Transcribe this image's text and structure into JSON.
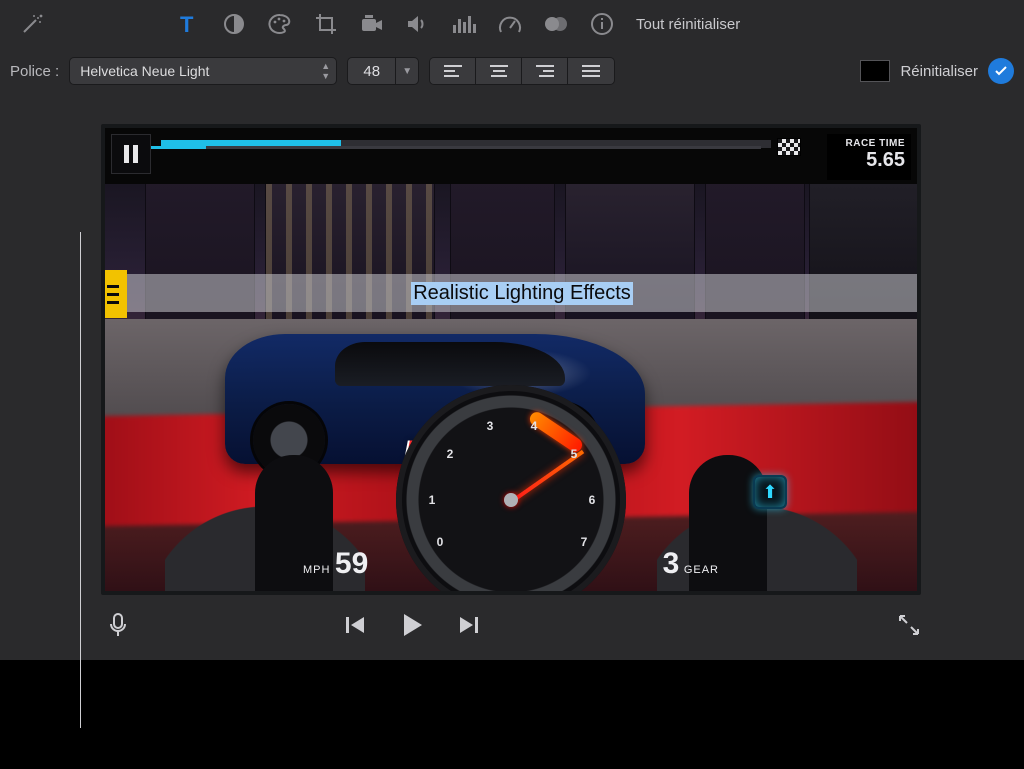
{
  "toolbar": {
    "reset_all": "Tout réinitialiser"
  },
  "font_row": {
    "label": "Police :",
    "font_name": "Helvetica Neue Light",
    "size": "48",
    "reinit": "Réinitialiser"
  },
  "viewer": {
    "race_time_label": "RACE TIME",
    "race_time_value": "5.65",
    "title_overlay": "Realistic Lighting Effects",
    "late_shift": "LATE SHIFT",
    "speed_label": "MPH",
    "speed_value": "59",
    "gear_value": "3",
    "gear_label": "GEAR",
    "gauge_numbers": [
      "0",
      "1",
      "2",
      "3",
      "4",
      "5",
      "6",
      "7"
    ]
  }
}
